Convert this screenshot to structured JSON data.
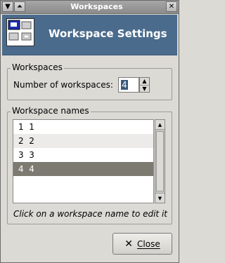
{
  "window": {
    "title": "Workspaces",
    "menu_icon": "menu-arrow-icon",
    "shade_icon": "shade-icon",
    "close_icon": "close-icon"
  },
  "banner": {
    "title": "Workspace Settings",
    "icon": "workspaces-icon"
  },
  "workspaces_section": {
    "label": "Workspaces",
    "count_label": "Number of workspaces:",
    "count_value": "4"
  },
  "names_section": {
    "label": "Workspace names",
    "rows": [
      "1  1",
      "2  2",
      "3  3",
      "4  4"
    ],
    "selected_index": 3,
    "hint": "Click on a workspace name to edit it"
  },
  "buttons": {
    "close_label": "Close"
  },
  "colors": {
    "banner": "#4a6b8c",
    "selection": "#7d7a72",
    "background": "#dcdad5"
  }
}
